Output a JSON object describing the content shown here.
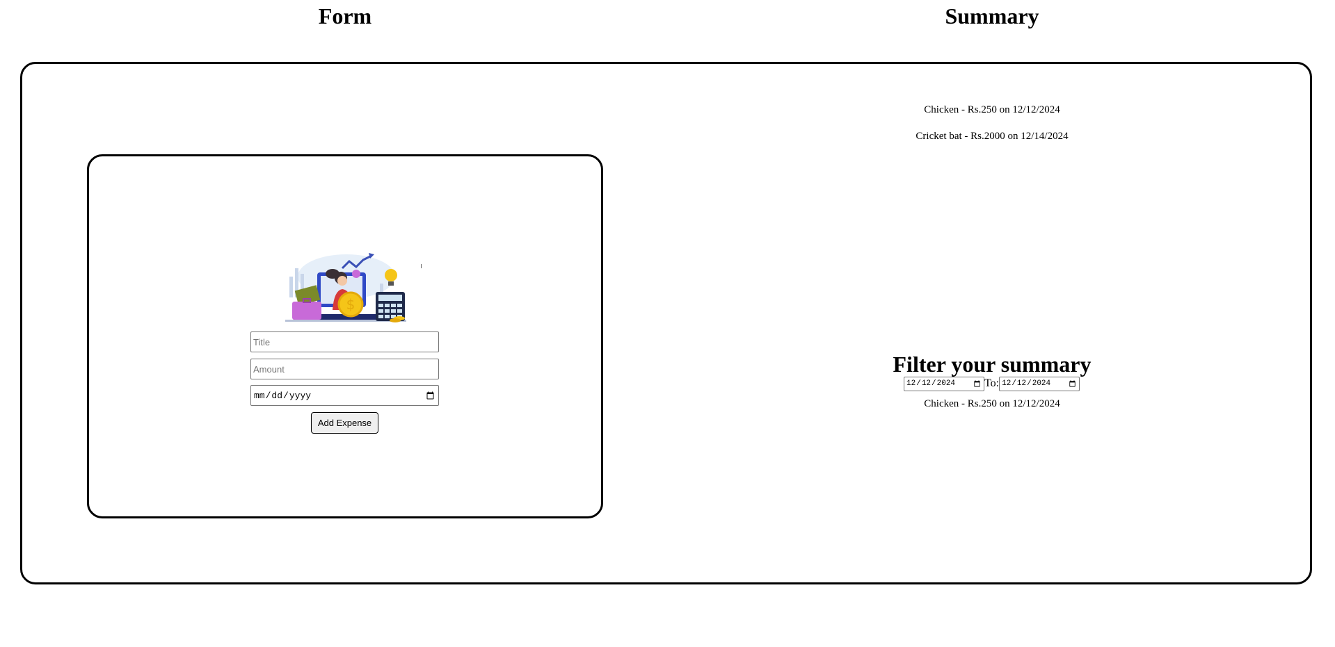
{
  "form": {
    "title": "Form",
    "title_placeholder": "Title",
    "amount_placeholder": "Amount",
    "date_placeholder": "dd-mm-yyyy",
    "submit_label": "Add Expense"
  },
  "summary": {
    "title": "Summary",
    "items": [
      "Chicken - Rs.250 on 12/12/2024",
      "Cricket bat - Rs.2000 on 12/14/2024"
    ]
  },
  "filter": {
    "title": "Filter your summary",
    "from_value": "2024-12-12",
    "to_label": "To:",
    "to_value": "2024-12-12",
    "results": [
      "Chicken - Rs.250 on 12/12/2024"
    ]
  },
  "colors": {
    "border": "#000000",
    "background": "#ffffff",
    "accent_blue": "#2f49c6",
    "coin_gold": "#f5c518",
    "bag_purple": "#c86ad8"
  },
  "icons": {
    "illustration": "finance-illustration"
  }
}
